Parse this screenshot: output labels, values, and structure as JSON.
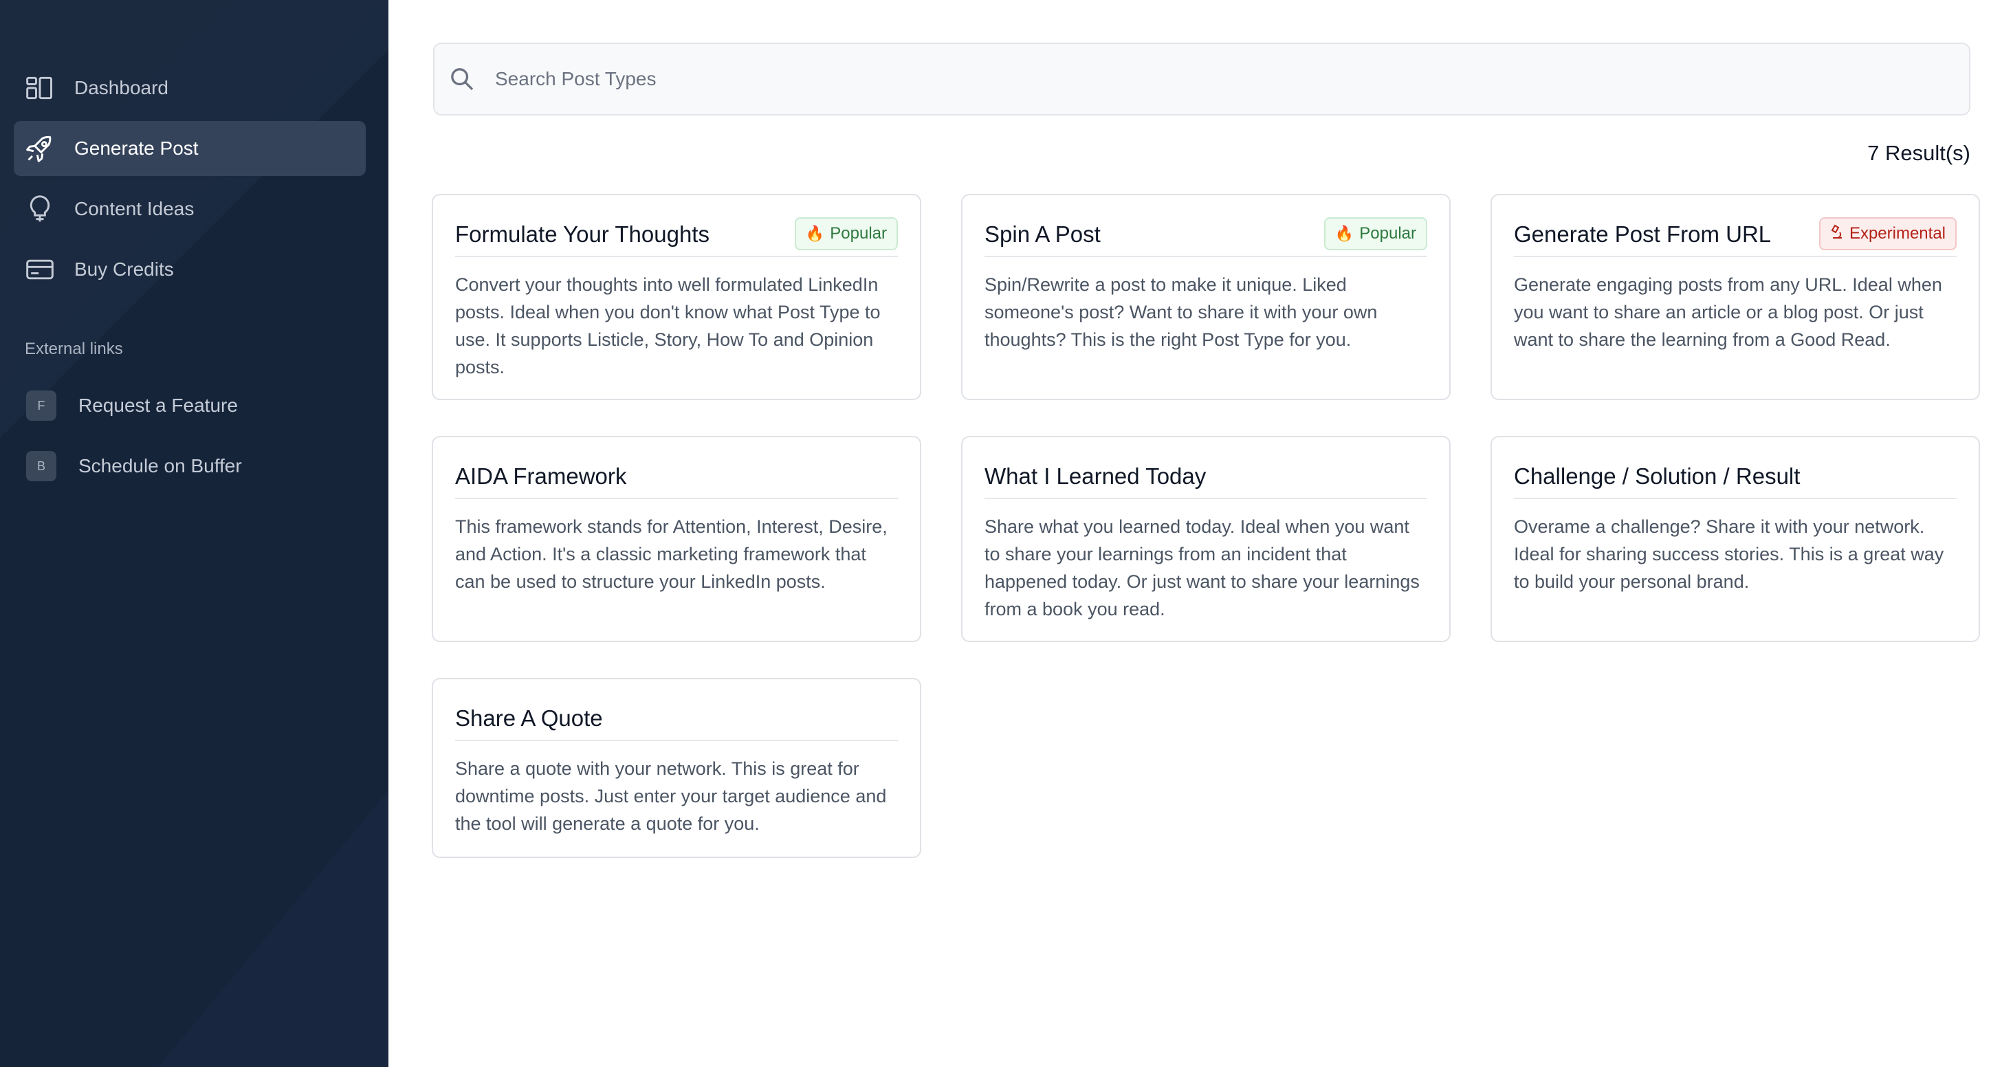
{
  "sidebar": {
    "nav": [
      {
        "label": "Dashboard",
        "icon": "dashboard-icon"
      },
      {
        "label": "Generate Post",
        "icon": "rocket-icon",
        "active": true
      },
      {
        "label": "Content Ideas",
        "icon": "lightbulb-icon"
      },
      {
        "label": "Buy Credits",
        "icon": "credit-card-icon"
      }
    ],
    "section_label": "External links",
    "external": [
      {
        "badge": "F",
        "label": "Request a Feature"
      },
      {
        "badge": "B",
        "label": "Schedule on Buffer"
      }
    ],
    "colors": {
      "background": "#16243a",
      "active": "#34435a"
    }
  },
  "search": {
    "placeholder": "Search Post Types",
    "value": ""
  },
  "results_label": "7 Result(s)",
  "cards": [
    {
      "title": "Formulate Your Thoughts",
      "badge": "Popular",
      "badge_type": "popular",
      "description": "Convert your thoughts into well formulated LinkedIn posts. Ideal when you don't know what Post Type to use. It supports Listicle, Story, How To and Opinion posts."
    },
    {
      "title": "Spin A Post",
      "badge": "Popular",
      "badge_type": "popular",
      "description": "Spin/Rewrite a post to make it unique. Liked someone's post? Want to share it with your own thoughts? This is the right Post Type for you."
    },
    {
      "title": "Generate Post From URL",
      "badge": "Experimental",
      "badge_type": "experimental",
      "description": "Generate engaging posts from any URL. Ideal when you want to share an article or a blog post. Or just want to share the learning from a Good Read."
    },
    {
      "title": "AIDA Framework",
      "badge": "",
      "badge_type": "",
      "description": "This framework stands for Attention, Interest, Desire, and Action. It's a classic marketing framework that can be used to structure your LinkedIn posts."
    },
    {
      "title": "What I Learned Today",
      "badge": "",
      "badge_type": "",
      "description": "Share what you learned today. Ideal when you want to share your learnings from an incident that happened today. Or just want to share your learnings from a book you read."
    },
    {
      "title": "Challenge / Solution / Result",
      "badge": "",
      "badge_type": "",
      "description": "Overame a challenge? Share it with your network. Ideal for sharing success stories. This is a great way to build your personal brand."
    },
    {
      "title": "Share A Quote",
      "badge": "",
      "badge_type": "",
      "description": "Share a quote with your network. This is great for downtime posts. Just enter your target audience and the tool will generate a quote for you."
    }
  ]
}
